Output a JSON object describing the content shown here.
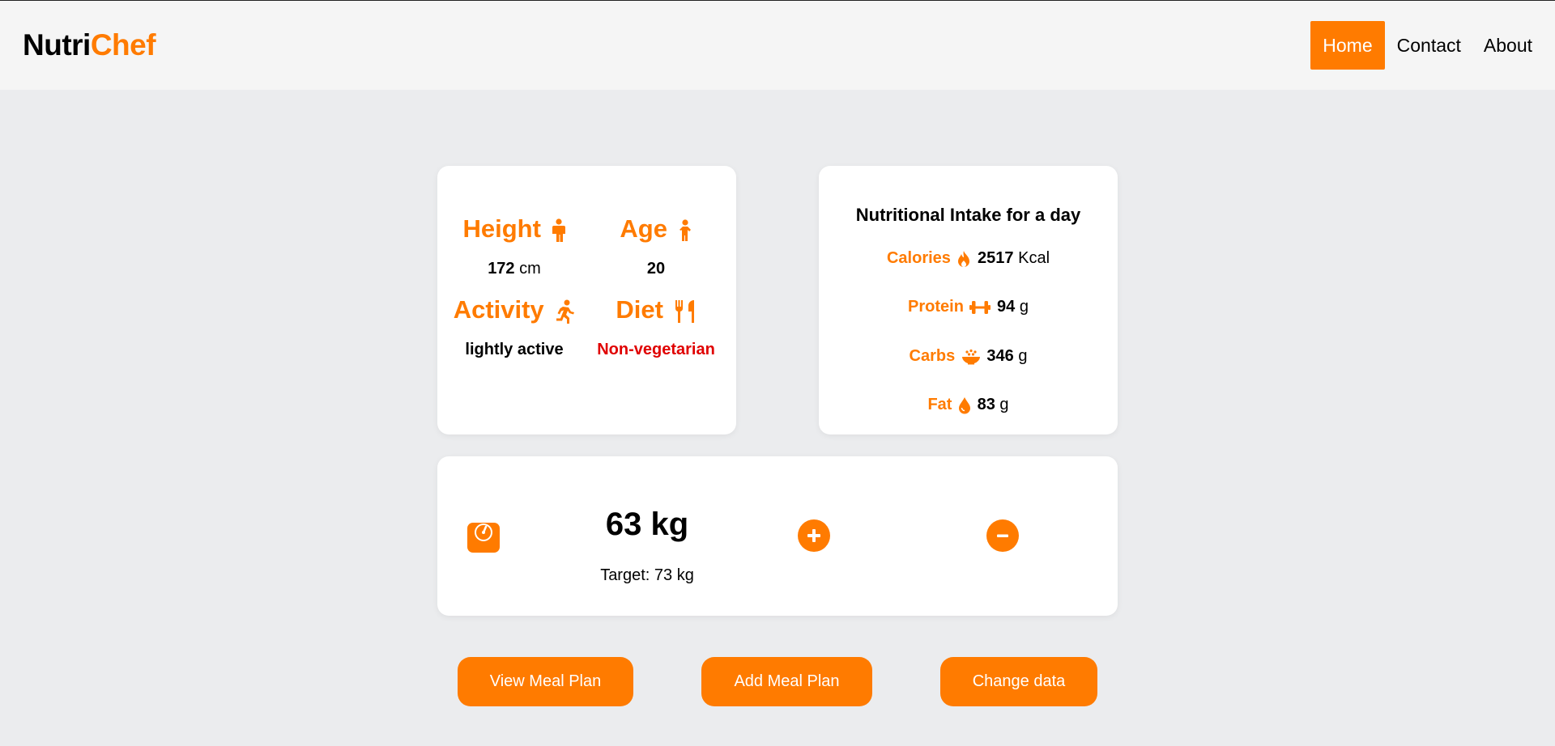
{
  "brand": {
    "part1": "Nutri",
    "part2": "Chef"
  },
  "nav": {
    "home": "Home",
    "contact": "Contact",
    "about": "About"
  },
  "profile": {
    "height_label": "Height",
    "height_value": "172",
    "height_unit": "cm",
    "age_label": "Age",
    "age_value": "20",
    "activity_label": "Activity",
    "activity_value": "lightly active",
    "diet_label": "Diet",
    "diet_value": "Non-vegetarian"
  },
  "nutrition": {
    "title": "Nutritional Intake for a day",
    "calories_label": "Calories",
    "calories_value": "2517",
    "calories_unit": "Kcal",
    "protein_label": "Protein",
    "protein_value": "94",
    "protein_unit": "g",
    "carbs_label": "Carbs",
    "carbs_value": "346",
    "carbs_unit": "g",
    "fat_label": "Fat",
    "fat_value": "83",
    "fat_unit": "g"
  },
  "weight": {
    "value": "63 kg",
    "target": "Target: 73 kg"
  },
  "actions": {
    "view": "View Meal Plan",
    "add": "Add Meal Plan",
    "change": "Change data"
  },
  "icons": {
    "height": "person-icon",
    "age": "child-icon",
    "activity": "running-icon",
    "diet": "utensils-icon",
    "calories": "fire-icon",
    "protein": "dumbbell-icon",
    "carbs": "bowl-rice-icon",
    "fat": "droplet-icon",
    "weight": "weight-scale-icon",
    "plus": "plus-circle-icon",
    "minus": "minus-circle-icon"
  },
  "colors": {
    "accent": "#ff7b00",
    "diet": "#e00000",
    "background": "#ebecee",
    "navbar": "#f5f5f5"
  }
}
